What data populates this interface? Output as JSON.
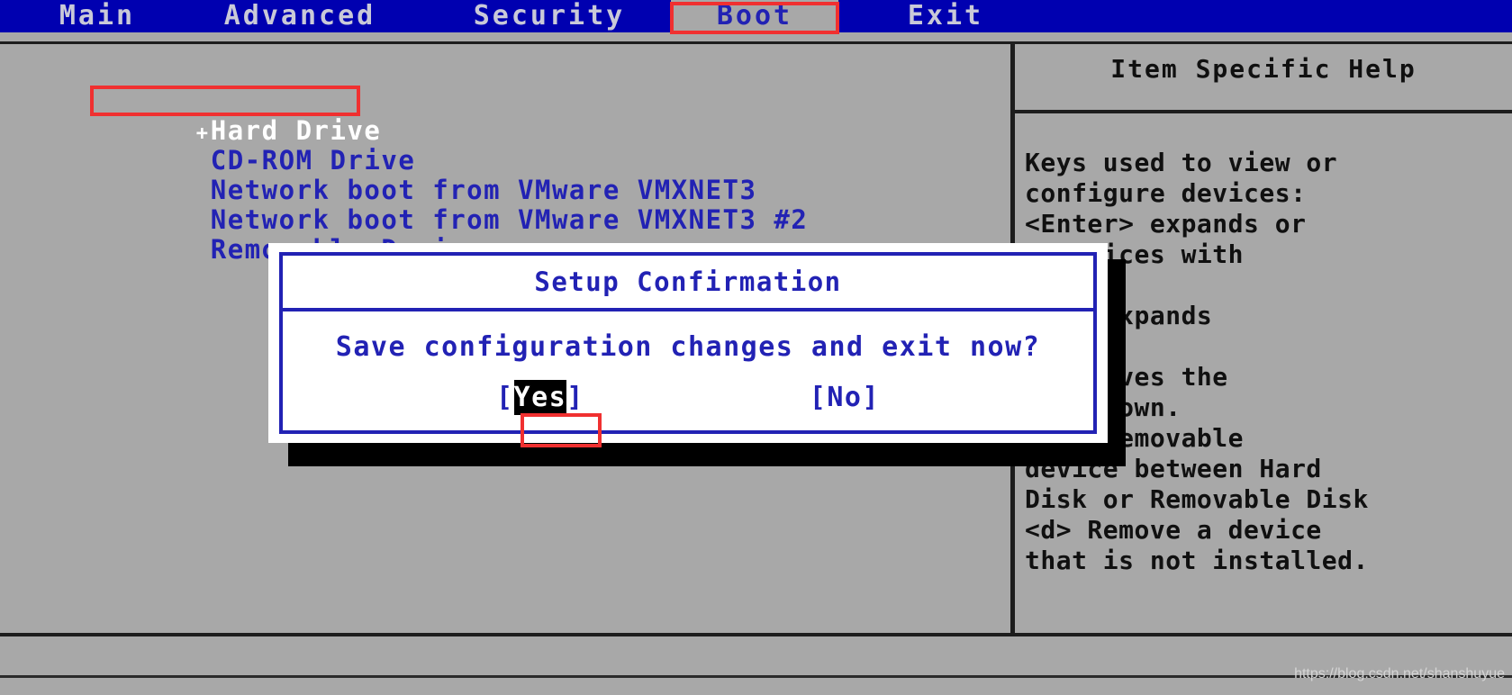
{
  "colors": {
    "menubar_bg": "#0000b0",
    "menu_text": "#c9c9d8",
    "panel_bg": "#a8a8a8",
    "bios_blue": "#2222b4",
    "selected_text": "#ffffff",
    "help_text": "#101010",
    "dialog_bg": "#ffffff",
    "highlight_bg": "#000000",
    "annotation_red": "#f03030"
  },
  "menubar": {
    "tabs": [
      {
        "label": "Main",
        "active": false
      },
      {
        "label": "Advanced",
        "active": false
      },
      {
        "label": "Security",
        "active": false
      },
      {
        "label": "Boot",
        "active": true
      },
      {
        "label": "Exit",
        "active": false
      }
    ]
  },
  "boot_list": {
    "items": [
      {
        "marker": "+",
        "label": "Hard Drive",
        "selected": true
      },
      {
        "marker": "",
        "label": "CD-ROM Drive",
        "selected": false
      },
      {
        "marker": "",
        "label": "Network boot from VMware VMXNET3",
        "selected": false
      },
      {
        "marker": "",
        "label": "Network boot from VMware VMXNET3 #2",
        "selected": false
      },
      {
        "marker": "",
        "label": "Removable Devices",
        "selected": false
      }
    ]
  },
  "help_panel": {
    "title": "Item Specific Help",
    "lines": [
      "Keys used to view or",
      "configure devices:",
      "<Enter> expands or",
      "s devices with",
      "",
      "ter> expands",
      "",
      "<-> moves the",
      "p or down.",
      "move removable",
      "device between Hard",
      "Disk or Removable Disk",
      "<d> Remove a device",
      "that is not installed."
    ]
  },
  "dialog": {
    "title": "Setup Confirmation",
    "message": "Save configuration changes and exit now?",
    "buttons": [
      {
        "label": "[Yes]",
        "bracket_open": "[",
        "text": "Yes",
        "bracket_close": "]",
        "highlighted": true
      },
      {
        "label": "[No]",
        "bracket_open": "[",
        "text": "No",
        "bracket_close": "]",
        "highlighted": false
      }
    ]
  },
  "annotations": [
    {
      "name": "boot-tab-highlight",
      "target": "Boot"
    },
    {
      "name": "hard-drive-highlight",
      "target": "Hard Drive"
    },
    {
      "name": "yes-button-highlight",
      "target": "[Yes]"
    }
  ],
  "watermark": {
    "text": "https://blog.csdn.net/shanshuyue"
  }
}
